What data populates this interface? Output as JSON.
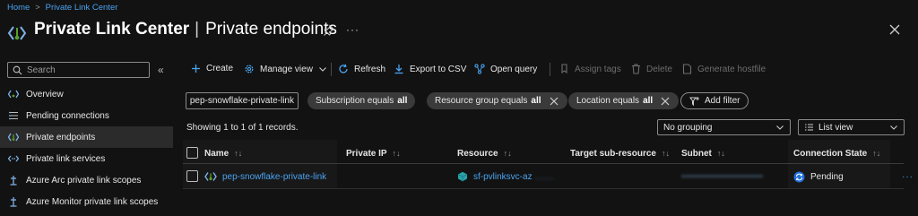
{
  "breadcrumb": {
    "home": "Home",
    "separator": ">",
    "current": "Private Link Center"
  },
  "header": {
    "title": "Private Link Center",
    "divider": "|",
    "subtitle": "Private endpoints",
    "more": "···"
  },
  "sidebar": {
    "search_placeholder": "Search",
    "collapse": "«",
    "items": [
      {
        "label": "Overview",
        "icon": "overview-icon"
      },
      {
        "label": "Pending connections",
        "icon": "list-icon"
      },
      {
        "label": "Private endpoints",
        "icon": "private-endpoint-icon",
        "selected": true
      },
      {
        "label": "Private link services",
        "icon": "link-services-icon"
      },
      {
        "label": "Azure Arc private link scopes",
        "icon": "scope-icon"
      },
      {
        "label": "Azure Monitor private link scopes",
        "icon": "scope-icon"
      }
    ]
  },
  "toolbar": {
    "create": "Create",
    "manage_view": "Manage view",
    "refresh": "Refresh",
    "export_csv": "Export to CSV",
    "open_query": "Open query",
    "assign_tags": "Assign tags",
    "delete": "Delete",
    "generate_hostfile": "Generate hostfile"
  },
  "filters": {
    "search_value": "pep-snowflake-private-link",
    "pills": [
      {
        "label": "Subscription equals",
        "value": "all",
        "removable": false
      },
      {
        "label": "Resource group equals",
        "value": "all",
        "removable": true
      },
      {
        "label": "Location equals",
        "value": "all",
        "removable": true
      }
    ],
    "add_filter": "Add filter"
  },
  "records_text": "Showing 1 to 1 of 1 records.",
  "grouping": {
    "selected": "No grouping"
  },
  "view": {
    "selected": "List view"
  },
  "table": {
    "columns": [
      "Name",
      "Private IP",
      "Resource",
      "Target sub-resource",
      "Subnet",
      "Connection State"
    ],
    "sort_glyph": "↑↓",
    "rows": [
      {
        "name": "pep-snowflake-private-link",
        "private_ip": "",
        "resource": "sf-pvlinksvc-az",
        "resource_tail": "........",
        "target_sub_resource": "",
        "subnet": "••••••••••••••••••••••••••",
        "connection_state": "Pending"
      }
    ],
    "row_more": "···"
  },
  "colors": {
    "accent": "#4aa3f0",
    "background": "#121212",
    "selected": "#2b2b2b",
    "pending": "#1f6fd6"
  }
}
